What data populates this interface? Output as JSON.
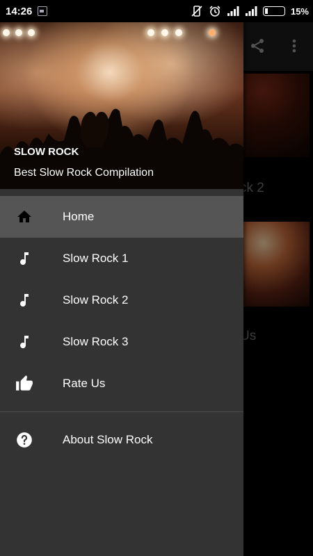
{
  "status_bar": {
    "time": "14:26",
    "battery_percent": "15%"
  },
  "drawer": {
    "header": {
      "title": "SLOW ROCK",
      "subtitle": "Best Slow Rock Compilation"
    },
    "items": [
      {
        "label": "Home",
        "icon": "home-icon",
        "active": true
      },
      {
        "label": "Slow Rock 1",
        "icon": "music-note-icon"
      },
      {
        "label": "Slow Rock 2",
        "icon": "music-note-icon"
      },
      {
        "label": "Slow Rock 3",
        "icon": "music-note-icon"
      },
      {
        "label": "Rate Us",
        "icon": "thumbs-up-icon"
      }
    ],
    "secondary_items": [
      {
        "label": "About Slow Rock",
        "icon": "help-icon"
      }
    ]
  },
  "background": {
    "visible_title_1": "ck 2",
    "visible_title_2": "Us"
  },
  "colors": {
    "drawer_bg": "#333333",
    "active_item_bg": "#555555",
    "text": "#ffffff"
  }
}
